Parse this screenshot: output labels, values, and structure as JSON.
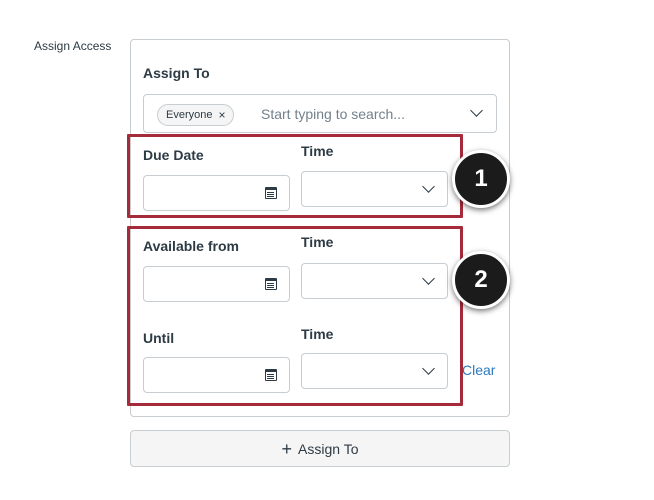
{
  "section_label": "Assign Access",
  "assign_to": {
    "label": "Assign To",
    "tag": "Everyone",
    "tag_remove_icon": "×",
    "placeholder": "Start typing to search..."
  },
  "due": {
    "date_label": "Due Date",
    "time_label": "Time"
  },
  "available": {
    "from_label": "Available from",
    "from_time_label": "Time",
    "until_label": "Until",
    "until_time_label": "Time"
  },
  "clear_label": "Clear",
  "add_button": {
    "icon": "+",
    "label": "Assign To"
  },
  "callouts": [
    "1",
    "2"
  ],
  "icons": {
    "calendar": "calendar-icon",
    "dropdown": "chevron-down-icon",
    "remove": "close-icon",
    "add": "plus-icon"
  },
  "colors": {
    "highlight": "#a52a3a",
    "link": "#2b7abc",
    "badge": "#1b1b1b"
  }
}
